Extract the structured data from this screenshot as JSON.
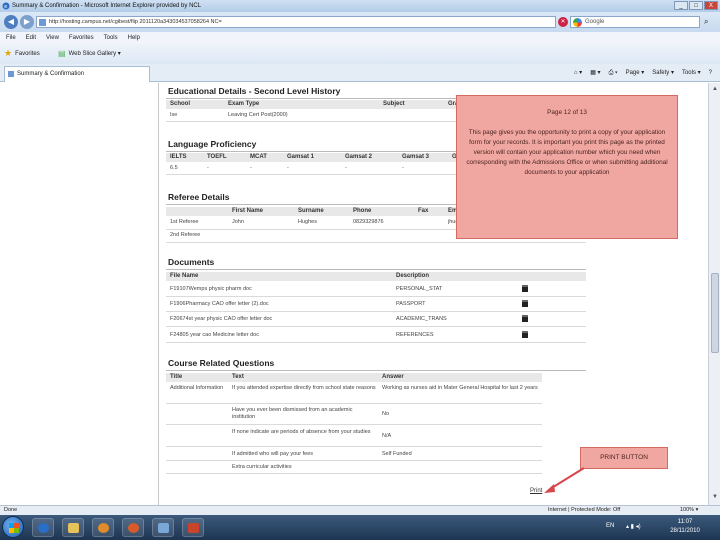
{
  "window": {
    "title": "Summary & Confirmation - Microsoft Internet Explorer provided by NCL",
    "controls": [
      "_",
      "□",
      "X"
    ]
  },
  "address": {
    "url": "http://hosting.campus.net/cgibest/flip 2011120a343034537058264 NC=",
    "search_placeholder": "Google"
  },
  "menu": [
    "File",
    "Edit",
    "View",
    "Favorites",
    "Tools",
    "Help"
  ],
  "favorites": {
    "favorites_label": "Favorites",
    "web_slice_label": "Web Slice Gallery ▾"
  },
  "tab": {
    "label": "Summary & Confirmation"
  },
  "commands": [
    "Page ▾",
    "Safety ▾",
    "Tools ▾",
    "?"
  ],
  "education": {
    "heading": "Educational Details - Second Level History",
    "headers": [
      "School",
      "Exam Type",
      "Subject",
      "Gra"
    ],
    "rows": [
      [
        "Ise",
        "Leaving Cert Post(2000)"
      ]
    ]
  },
  "language": {
    "heading": "Language Proficiency",
    "headers": [
      "IELTS",
      "TOEFL",
      "MCAT",
      "Gamsat 1",
      "Gamsat 2",
      "Gamsat 3",
      "G"
    ],
    "rows": [
      [
        "6.5",
        "-",
        "-",
        "-",
        "-",
        "-"
      ]
    ]
  },
  "referee": {
    "heading": "Referee Details",
    "headers": [
      "First Name",
      "Surname",
      "Phone",
      "Fax",
      "Ema"
    ],
    "rows": [
      [
        "1st Referee",
        "John",
        "Hughes",
        "0829329876",
        "",
        "jhug"
      ],
      [
        "2nd Referee",
        "",
        "",
        "",
        "",
        ""
      ]
    ]
  },
  "documents": {
    "heading": "Documents",
    "headers": [
      "File Name",
      "Description"
    ],
    "rows": [
      [
        "F19107Wemps physic pharm doc",
        "PERSONAL_STAT"
      ],
      [
        "F1906Pharmacy CAO offer letter (2).doc",
        "PASSPORT"
      ],
      [
        "F20674st year physic CAO offer letter doc",
        "ACADEMIC_TRANS"
      ],
      [
        "F24805 year cao Medicine letter doc",
        "REFERENCES"
      ]
    ]
  },
  "course": {
    "heading": "Course Related Questions",
    "headers": [
      "Title",
      "Text",
      "Answer"
    ],
    "rows": [
      [
        "Additional Information",
        "If you attended expertise directly from school state reasons",
        "Working as nurses aid in Mater General Hospital for last 2 years"
      ],
      [
        "",
        "Have you ever been dismissed from an academic institution",
        "No"
      ],
      [
        "",
        "If none indicate are periods of absence from your studies",
        "N/A"
      ],
      [
        "",
        "If admitted who will pay your fees",
        "Self Funded"
      ],
      [
        "",
        "Extra curricular activities",
        ""
      ]
    ]
  },
  "annotations": {
    "page_indicator": "Page 12 of 13",
    "info_text": "This page gives you the opportunity to print a copy of your application form for your records. It is important you print this page as the printed version will contain your application number which you need when corresponding with the Admissions Office or when submitting additional documents to your application",
    "print_button_label": "PRINT BUTTON",
    "print_link": "Print",
    "color_box": "#f1a7a1",
    "color_arrow": "#d6474c"
  },
  "status": {
    "left": "Done",
    "middle": "Internet | Protected Mode: Off",
    "zoom": "100% ▾"
  },
  "taskbar": {
    "apps": [
      "ie",
      "explorer",
      "media",
      "firefox",
      "paint",
      "powerpoint"
    ],
    "lang": "EN",
    "time": "11:07",
    "date": "28/11/2010"
  }
}
